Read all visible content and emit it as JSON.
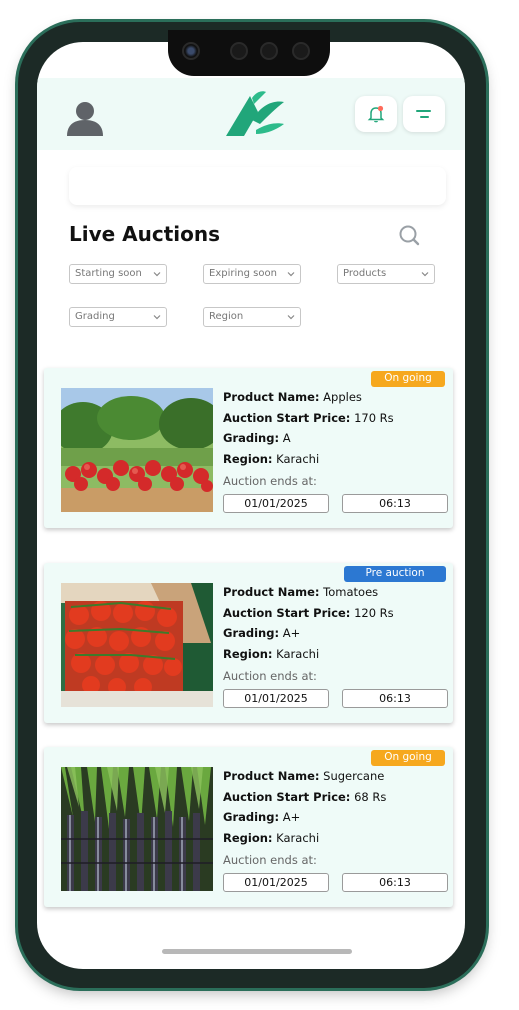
{
  "header": {
    "avatar_icon": "user-avatar-icon",
    "logo_icon": "leaf-logo-icon",
    "bell_icon": "bell-icon",
    "menu_icon": "menu-icon",
    "accent": "#21a67a",
    "bell_dot": "#ff6b5b"
  },
  "page": {
    "title": "Live Auctions",
    "search_icon": "search-icon"
  },
  "filters": {
    "starting_soon": "Starting soon",
    "expiring_soon": "Expiring soon",
    "products": "Products",
    "grading": "Grading",
    "region": "Region"
  },
  "labels": {
    "product_name": "Product Name:",
    "start_price": "Auction Start Price:",
    "grading": "Grading:",
    "region": "Region:",
    "ends_at": "Auction ends at:"
  },
  "auctions": [
    {
      "status": "On going",
      "product": "Apples",
      "price": "170 Rs",
      "grade": "A",
      "region": "Karachi",
      "end_date": "01/01/2025",
      "end_time": "06:13"
    },
    {
      "status": "Pre auction",
      "product": "Tomatoes",
      "price": "120 Rs",
      "grade": "A+",
      "region": "Karachi",
      "end_date": "01/01/2025",
      "end_time": "06:13"
    },
    {
      "status": "On going",
      "product": "Sugercane",
      "price": "68 Rs",
      "grade": "A+",
      "region": "Karachi",
      "end_date": "01/01/2025",
      "end_time": "06:13"
    }
  ],
  "colors": {
    "ongoing": "#f6a81e",
    "pre_auction": "#2c78d2",
    "card_bg": "#effbf8"
  }
}
